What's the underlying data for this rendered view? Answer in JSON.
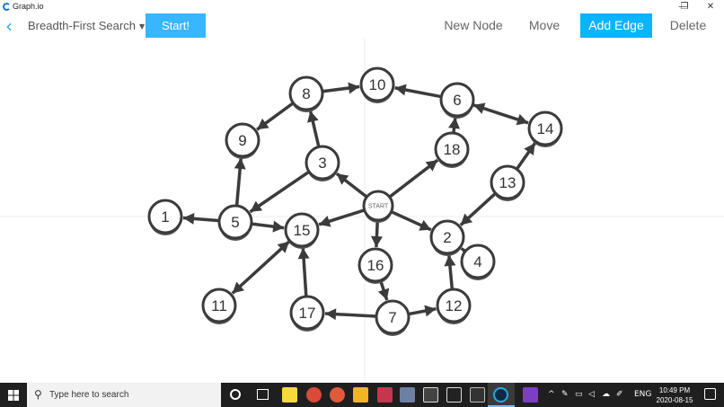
{
  "window": {
    "title": "Graph.io",
    "controls": {
      "minimize": "—",
      "maximize": "❐",
      "close": "✕"
    }
  },
  "toolbar": {
    "algorithm": "Breadth-First Search",
    "start_label": "Start!",
    "new_node_label": "New Node",
    "move_label": "Move",
    "add_edge_label": "Add Edge",
    "delete_label": "Delete",
    "active_tool": "Add Edge"
  },
  "graph": {
    "start_label": "START",
    "nodes": [
      {
        "id": "1",
        "label": "1"
      },
      {
        "id": "2",
        "label": "2"
      },
      {
        "id": "3",
        "label": "3"
      },
      {
        "id": "4",
        "label": "4"
      },
      {
        "id": "5",
        "label": "5"
      },
      {
        "id": "6",
        "label": "6"
      },
      {
        "id": "7",
        "label": "7"
      },
      {
        "id": "8",
        "label": "8"
      },
      {
        "id": "9",
        "label": "9"
      },
      {
        "id": "10",
        "label": "10"
      },
      {
        "id": "11",
        "label": "11"
      },
      {
        "id": "12",
        "label": "12"
      },
      {
        "id": "13",
        "label": "13"
      },
      {
        "id": "14",
        "label": "14"
      },
      {
        "id": "15",
        "label": "15"
      },
      {
        "id": "16",
        "label": "16"
      },
      {
        "id": "17",
        "label": "17"
      },
      {
        "id": "18",
        "label": "18"
      },
      {
        "id": "S",
        "label": "START"
      }
    ],
    "edges": [
      {
        "from": "S",
        "to": "3"
      },
      {
        "from": "S",
        "to": "18"
      },
      {
        "from": "S",
        "to": "15"
      },
      {
        "from": "S",
        "to": "16"
      },
      {
        "from": "S",
        "to": "2"
      },
      {
        "from": "3",
        "to": "8"
      },
      {
        "from": "3",
        "to": "5"
      },
      {
        "from": "8",
        "to": "10"
      },
      {
        "from": "8",
        "to": "9"
      },
      {
        "from": "6",
        "to": "10"
      },
      {
        "from": "18",
        "to": "6"
      },
      {
        "from": "6",
        "to": "14",
        "bidirectional": true
      },
      {
        "from": "13",
        "to": "14"
      },
      {
        "from": "13",
        "to": "2"
      },
      {
        "from": "5",
        "to": "9"
      },
      {
        "from": "5",
        "to": "1"
      },
      {
        "from": "5",
        "to": "15"
      },
      {
        "from": "15",
        "to": "11",
        "bidirectional": true
      },
      {
        "from": "17",
        "to": "15"
      },
      {
        "from": "16",
        "to": "7"
      },
      {
        "from": "7",
        "to": "17"
      },
      {
        "from": "7",
        "to": "12"
      },
      {
        "from": "12",
        "to": "2"
      },
      {
        "from": "4",
        "to": "2"
      }
    ]
  },
  "taskbar": {
    "search_placeholder": "Type here to search",
    "language": "ENG",
    "time": "10:49 PM",
    "date": "2020-08-15"
  },
  "colors": {
    "accent": "#38b6ff",
    "active_tool": "#0ab4ff",
    "back_arrow": "#29a8e0",
    "node_stroke": "#3b3b3b",
    "edge": "#3b3b3b",
    "taskbar": "#1f1f1f"
  }
}
